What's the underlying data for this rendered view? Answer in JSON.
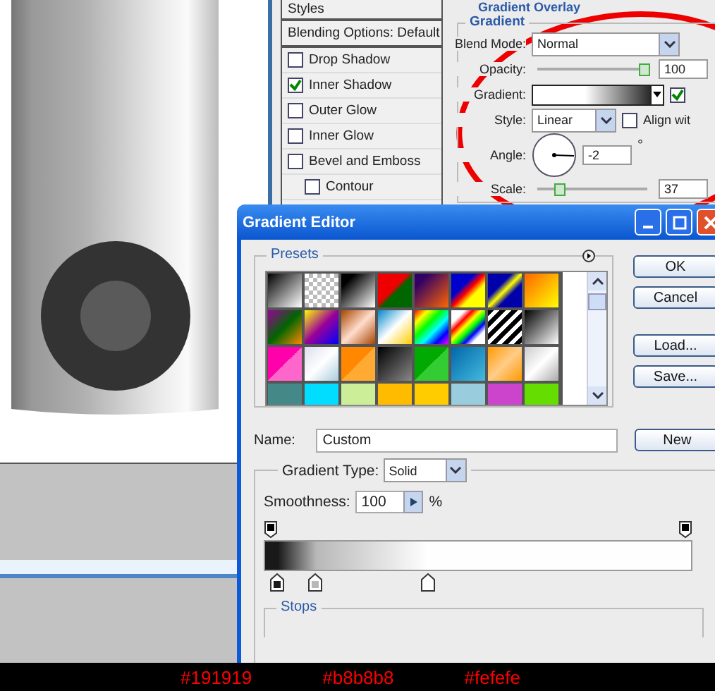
{
  "layer_style": {
    "styles_header": "Styles",
    "blending_options": "Blending Options: Default",
    "effects": [
      {
        "label": "Drop Shadow",
        "checked": false
      },
      {
        "label": "Inner Shadow",
        "checked": true
      },
      {
        "label": "Outer Glow",
        "checked": false
      },
      {
        "label": "Inner Glow",
        "checked": false
      },
      {
        "label": "Bevel and Emboss",
        "checked": false,
        "children": [
          {
            "label": "Contour",
            "checked": false
          }
        ]
      }
    ]
  },
  "gradient_overlay": {
    "title": "Gradient Overlay",
    "group": "Gradient",
    "blend_mode": {
      "label": "Blend Mode:",
      "value": "Normal"
    },
    "opacity": {
      "label": "Opacity:",
      "level": 0.97,
      "value": "100"
    },
    "gradient": {
      "label": "Gradient:",
      "reverse_checked": true
    },
    "style": {
      "label": "Style:",
      "value": "Linear"
    },
    "align": {
      "label": "Align wit",
      "checked": false
    },
    "angle": {
      "label": "Angle:",
      "value": "-2",
      "unit": "°"
    },
    "scale": {
      "label": "Scale:",
      "level": 0.2,
      "value": "37"
    }
  },
  "gradient_editor": {
    "title": "Gradient Editor",
    "presets_label": "Presets",
    "buttons": [
      {
        "label": "OK"
      },
      {
        "label": "Cancel"
      },
      {
        "label": "Load..."
      },
      {
        "label": "Save..."
      }
    ],
    "name_label": "Name:",
    "name_value": "Custom",
    "new_button": "New",
    "gradient_type_label": "Gradient Type:",
    "gradient_type": "Solid",
    "smoothness_label": "Smoothness:",
    "smoothness": "100",
    "percent": "%",
    "stops_label": "Stops",
    "color_stops": [
      {
        "color": "#191919",
        "level": 0.03
      },
      {
        "color": "#b8b8b8",
        "level": 0.12
      },
      {
        "color": "#fefefe",
        "level": 0.38
      }
    ]
  },
  "captions": [
    "#191919",
    "#b8b8b8",
    "#fefefe"
  ]
}
